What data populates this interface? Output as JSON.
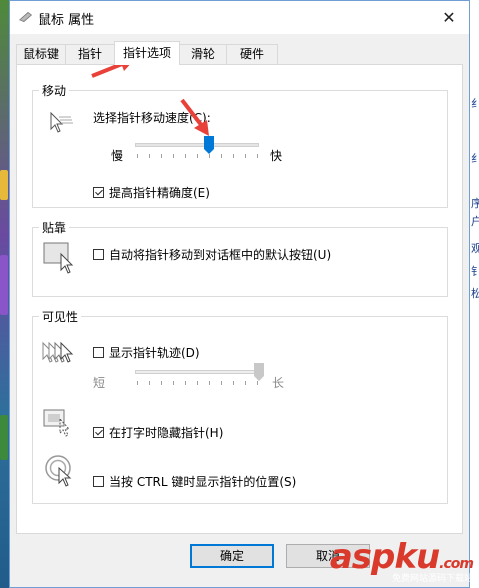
{
  "window": {
    "title": "鼠标 属性",
    "close_glyph": "✕"
  },
  "tabs": [
    {
      "label": "鼠标键"
    },
    {
      "label": "指针"
    },
    {
      "label": "指针选项"
    },
    {
      "label": "滑轮"
    },
    {
      "label": "硬件"
    }
  ],
  "active_tab": "指针选项",
  "motion": {
    "title": "移动",
    "speed_label": "选择指针移动速度(C):",
    "slow": "慢",
    "fast": "快",
    "speed_value": 0.6,
    "precision_label": "提高指针精确度(E)",
    "precision_checked": true
  },
  "snap": {
    "title": "贴靠",
    "label": "自动将指针移动到对话框中的默认按钮(U)",
    "checked": false
  },
  "visibility": {
    "title": "可见性",
    "trails_label": "显示指针轨迹(D)",
    "trails_checked": false,
    "short": "短",
    "long": "长",
    "trails_value": 1.0,
    "hide_label": "在打字时隐藏指针(H)",
    "hide_checked": true,
    "ctrl_label": "当按 CTRL 键时显示指针的位置(S)",
    "ctrl_checked": false
  },
  "buttons": {
    "ok": "确定",
    "cancel": "取消"
  },
  "watermark": {
    "main": "aspku",
    "domain": ".com",
    "sub": "免费网站源码下载站"
  },
  "background_right_chars": [
    "纟",
    "纟",
    "序",
    "户",
    "观",
    "钅",
    "松"
  ],
  "colors": {
    "accent": "#0078d7",
    "arrow": "#e8413a"
  }
}
